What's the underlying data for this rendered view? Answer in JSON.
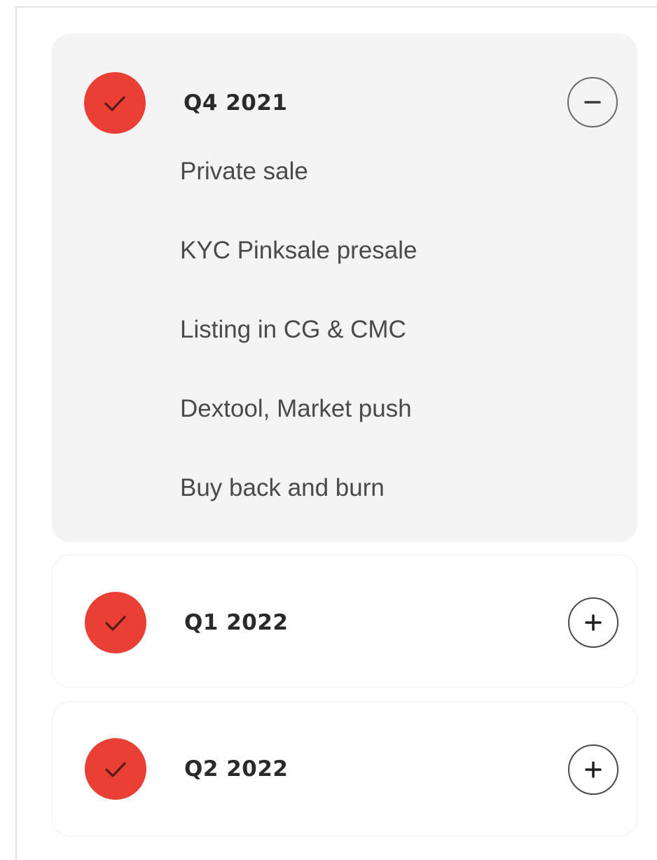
{
  "colors": {
    "check_bg": "#ea3f35",
    "check_mark": "#5a1a16",
    "open_card_bg": "#f4f4f4"
  },
  "roadmap": [
    {
      "title": "Q4 2021",
      "expanded": true,
      "toggle_icon": "minus-icon",
      "status_icon": "check-icon",
      "items": [
        "Private sale",
        "KYC Pinksale presale",
        "Listing in CG & CMC",
        "Dextool, Market push",
        "Buy back and burn"
      ]
    },
    {
      "title": "Q1 2022",
      "expanded": false,
      "toggle_icon": "plus-icon",
      "status_icon": "check-icon"
    },
    {
      "title": "Q2 2022",
      "expanded": false,
      "toggle_icon": "plus-icon",
      "status_icon": "check-icon"
    }
  ]
}
